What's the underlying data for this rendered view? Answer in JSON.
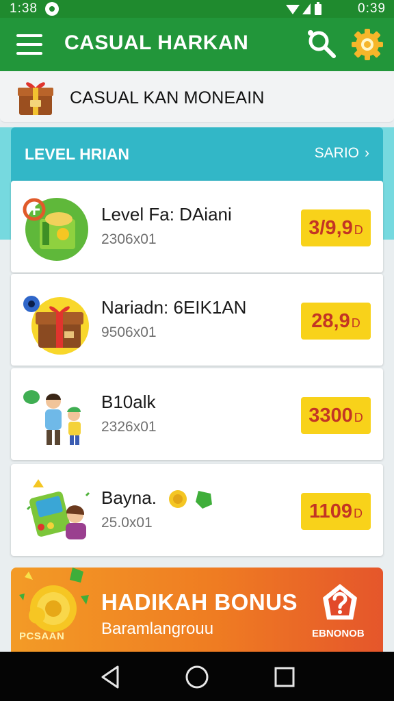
{
  "status_bar": {
    "time": "1:38",
    "clock": "0:39"
  },
  "app_bar": {
    "title": "CASUAL HARKAN",
    "menu_icon": "menu-icon",
    "search_icon": "search-icon",
    "settings_icon": "settings-icon"
  },
  "promo": {
    "text": "CASUAL KAN MONEAIN",
    "icon": "gift-box-icon"
  },
  "level": {
    "title": "LEVEL HRIAN",
    "link_label": "SARIO",
    "link_icon": "chevron-right-icon"
  },
  "items": [
    {
      "title": "Level Fa: DAiani",
      "subtitle": "2306x01",
      "price": "3/9,9",
      "unit": "D",
      "art": "cash-bag-icon"
    },
    {
      "title": "Nariadn: 6EIK1AN",
      "subtitle": "9506x01",
      "price": "28,9",
      "unit": "D",
      "art": "treasure-chest-icon"
    },
    {
      "title": "B10alk",
      "subtitle": "2326x01",
      "price": "3300",
      "unit": "D",
      "art": "family-icon"
    },
    {
      "title": "Bayna.",
      "subtitle": "25.0x01",
      "price": "1109",
      "unit": "D",
      "art": "arcade-machine-icon"
    }
  ],
  "bonus": {
    "title": "HADIKAH BONUS",
    "subtitle": "Baramlangrouu",
    "caption": "PCSAAN",
    "button_label": "EBNONOB",
    "icon": "question-badge-icon"
  },
  "nav": {
    "back_icon": "back-icon",
    "home_icon": "home-icon",
    "recents_icon": "recents-icon"
  },
  "colors": {
    "app_bar": "#22963a",
    "status_bar": "#1f8a2e",
    "level_panel": "#32b7c7",
    "price_badge": "#f8d21a",
    "price_text": "#c33524",
    "bonus_start": "#f39b26",
    "bonus_end": "#e5562b"
  }
}
